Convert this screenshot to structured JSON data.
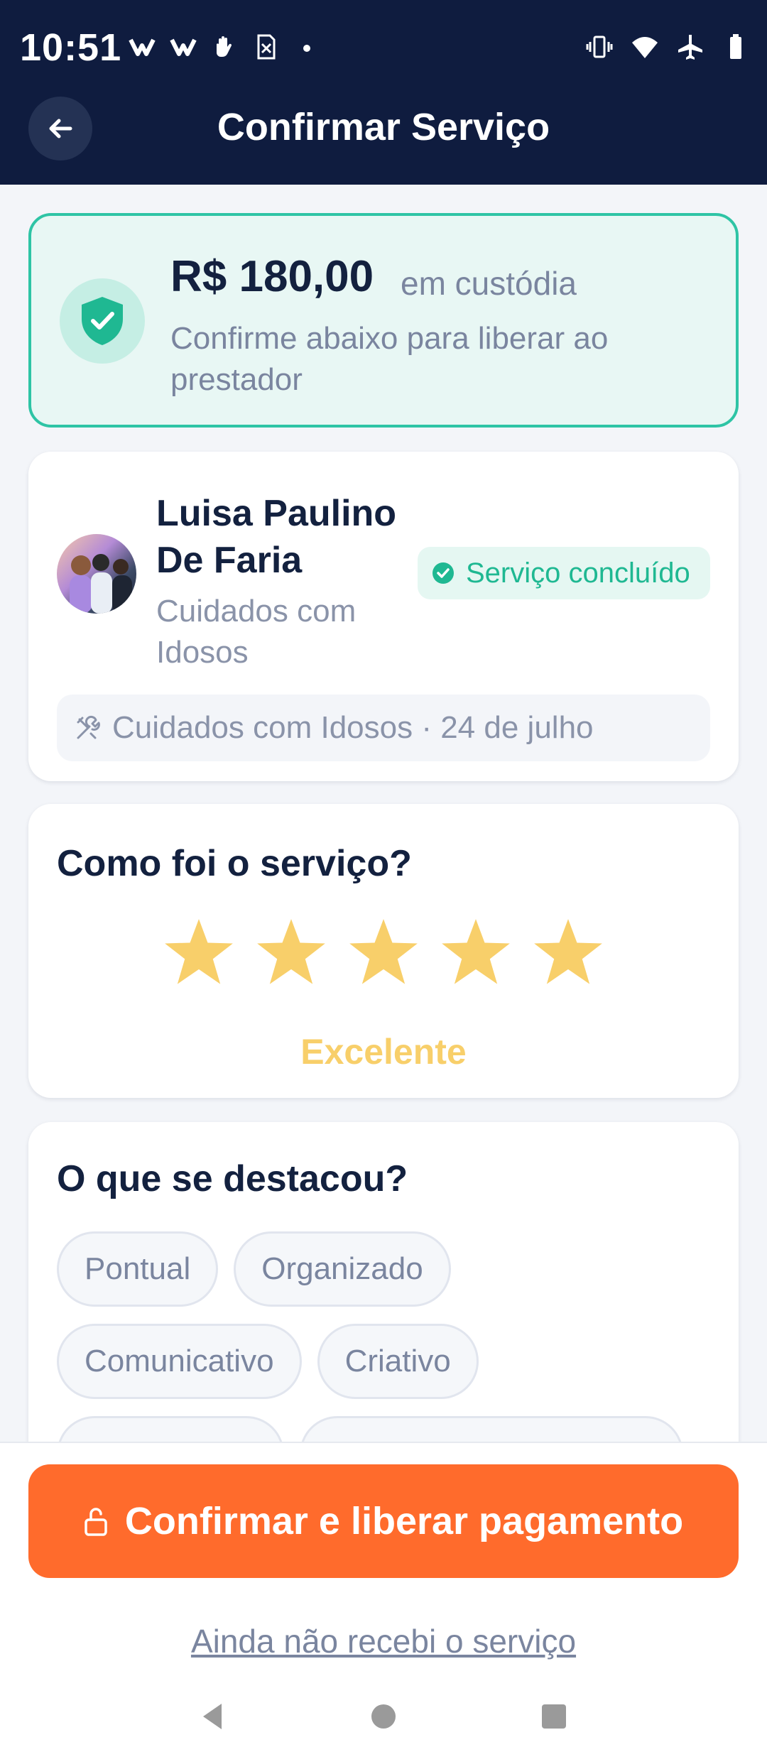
{
  "status_bar": {
    "time": "10:51",
    "left_icons": [
      "notification-v-icon",
      "notification-v-icon",
      "hand-icon",
      "sim-card-icon",
      "dot-icon"
    ],
    "right_icons": [
      "vibrate-icon",
      "wifi-icon",
      "airplane-icon",
      "battery-icon"
    ]
  },
  "header": {
    "title": "Confirmar Serviço",
    "back_icon": "arrow-left-icon"
  },
  "escrow": {
    "amount": "R$ 180,00",
    "status": "em custódia",
    "description": "Confirme abaixo para liberar ao prestador",
    "icon": "shield-check-icon"
  },
  "provider": {
    "name": "Luisa Paulino De Faria",
    "category": "Cuidados com Idosos",
    "badge": "Serviço concluído",
    "service_info": "Cuidados com Idosos · 24 de julho",
    "service_icon": "tools-icon"
  },
  "rating": {
    "heading": "Como foi o serviço?",
    "stars": 5,
    "max_stars": 5,
    "label": "Excelente"
  },
  "highlights": {
    "heading": "O que se destacou?",
    "chips_row_1": [
      "Pontual",
      "Organizado"
    ],
    "chips_row_2": [
      "Comunicativo",
      "Criativo"
    ]
  },
  "actions": {
    "confirm_label": "Confirmar e liberar pagamento",
    "confirm_icon": "unlock-icon",
    "not_received_label": "Ainda não recebi o serviço"
  },
  "colors": {
    "header_bg": "#0F1C3F",
    "escrow_border": "#2EC4A5",
    "success": "#1FB892",
    "star": "#F8CF6A",
    "primary_button": "#FF6B2C"
  }
}
